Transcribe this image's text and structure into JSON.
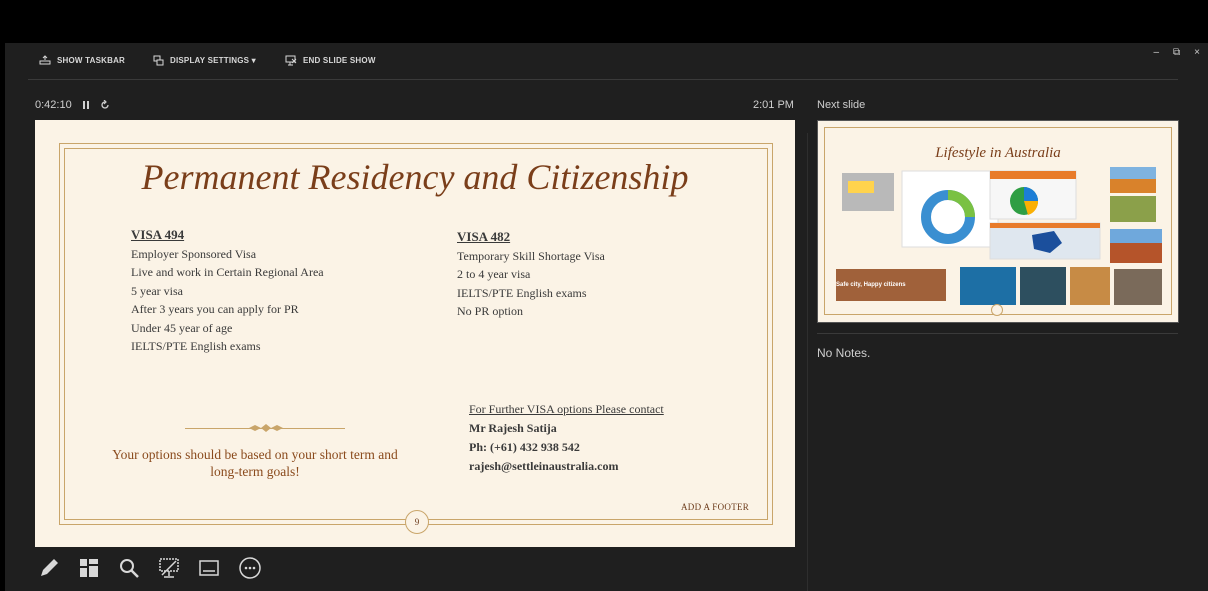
{
  "toolbar": {
    "show_taskbar": "SHOW TASKBAR",
    "display_settings": "DISPLAY SETTINGS ▾",
    "end_slide_show": "END SLIDE SHOW"
  },
  "window": {
    "minimize": "–",
    "restore": "⧉",
    "close": "×"
  },
  "presenter": {
    "elapsed_time": "0:42:10",
    "pause_icon": "pause-icon",
    "restart_icon": "restart-icon",
    "clock": "2:01 PM",
    "next_slide_label": "Next slide",
    "notes": "No Notes."
  },
  "slide": {
    "title": "Permanent Residency and Citizenship",
    "left_column": {
      "heading": "VISA 494",
      "lines": [
        "Employer Sponsored Visa",
        "Live and work in Certain Regional Area",
        "5 year visa",
        "After 3 years you can apply for PR",
        "Under 45 year of age",
        "IELTS/PTE English exams"
      ]
    },
    "right_column": {
      "heading": "VISA 482",
      "lines": [
        "Temporary Skill Shortage Visa",
        "2 to 4 year visa",
        "IELTS/PTE English exams",
        "No PR option"
      ]
    },
    "options_text": "Your options should be based on your short term and long-term goals!",
    "contact": {
      "heading": "For Further VISA options Please contact",
      "name": "Mr Rajesh Satija",
      "phone": "Ph: (+61) 432 938 542",
      "email": "rajesh@settleinaustralia.com"
    },
    "footer": "ADD A FOOTER",
    "number": "9"
  },
  "next_slide": {
    "title": "Lifestyle in Australia",
    "banner": "Safe city, Happy citizens"
  },
  "bottom_tools": [
    "pen-icon",
    "see-all-slides-icon",
    "zoom-icon",
    "black-screen-icon",
    "subtitles-icon",
    "more-options-icon"
  ],
  "colors": {
    "background": "#1f1f1f",
    "slide_bg": "#fbf3e6",
    "title_brown": "#7a3e1a",
    "gold": "#c9a56a"
  }
}
